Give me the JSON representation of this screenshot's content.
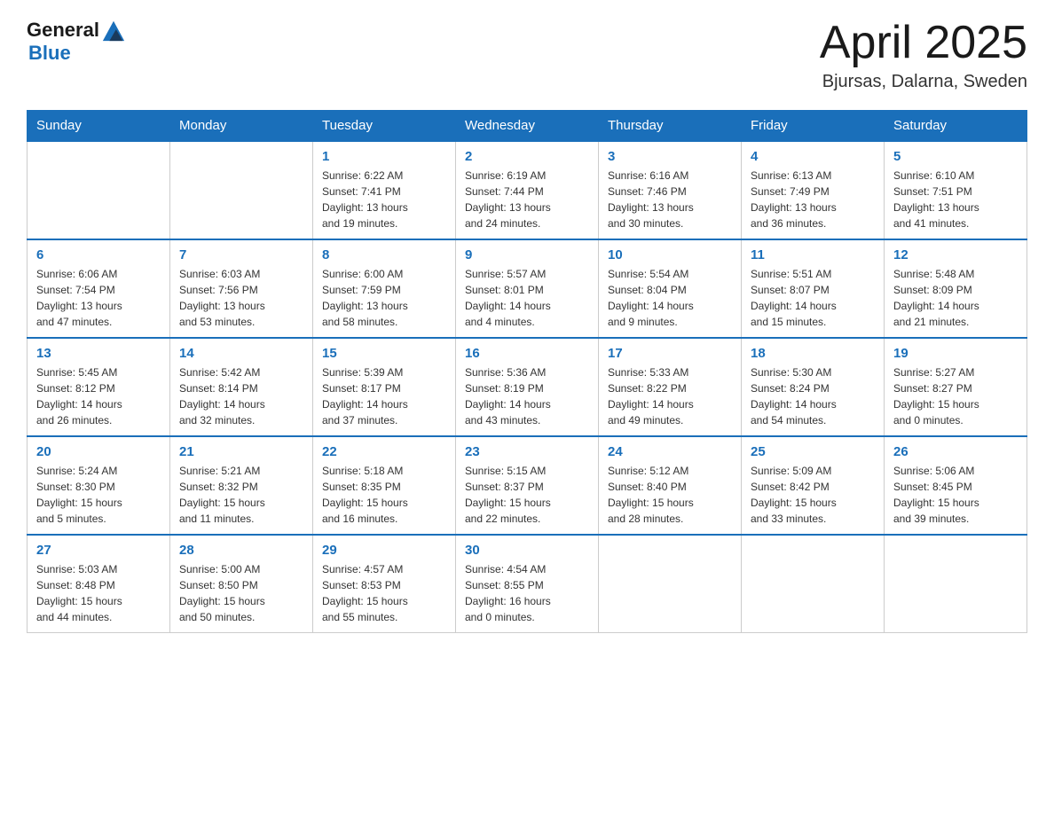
{
  "header": {
    "logo_general": "General",
    "logo_blue": "Blue",
    "month_title": "April 2025",
    "location": "Bjursas, Dalarna, Sweden"
  },
  "weekdays": [
    "Sunday",
    "Monday",
    "Tuesday",
    "Wednesday",
    "Thursday",
    "Friday",
    "Saturday"
  ],
  "weeks": [
    [
      {
        "day": "",
        "info": ""
      },
      {
        "day": "",
        "info": ""
      },
      {
        "day": "1",
        "info": "Sunrise: 6:22 AM\nSunset: 7:41 PM\nDaylight: 13 hours\nand 19 minutes."
      },
      {
        "day": "2",
        "info": "Sunrise: 6:19 AM\nSunset: 7:44 PM\nDaylight: 13 hours\nand 24 minutes."
      },
      {
        "day": "3",
        "info": "Sunrise: 6:16 AM\nSunset: 7:46 PM\nDaylight: 13 hours\nand 30 minutes."
      },
      {
        "day": "4",
        "info": "Sunrise: 6:13 AM\nSunset: 7:49 PM\nDaylight: 13 hours\nand 36 minutes."
      },
      {
        "day": "5",
        "info": "Sunrise: 6:10 AM\nSunset: 7:51 PM\nDaylight: 13 hours\nand 41 minutes."
      }
    ],
    [
      {
        "day": "6",
        "info": "Sunrise: 6:06 AM\nSunset: 7:54 PM\nDaylight: 13 hours\nand 47 minutes."
      },
      {
        "day": "7",
        "info": "Sunrise: 6:03 AM\nSunset: 7:56 PM\nDaylight: 13 hours\nand 53 minutes."
      },
      {
        "day": "8",
        "info": "Sunrise: 6:00 AM\nSunset: 7:59 PM\nDaylight: 13 hours\nand 58 minutes."
      },
      {
        "day": "9",
        "info": "Sunrise: 5:57 AM\nSunset: 8:01 PM\nDaylight: 14 hours\nand 4 minutes."
      },
      {
        "day": "10",
        "info": "Sunrise: 5:54 AM\nSunset: 8:04 PM\nDaylight: 14 hours\nand 9 minutes."
      },
      {
        "day": "11",
        "info": "Sunrise: 5:51 AM\nSunset: 8:07 PM\nDaylight: 14 hours\nand 15 minutes."
      },
      {
        "day": "12",
        "info": "Sunrise: 5:48 AM\nSunset: 8:09 PM\nDaylight: 14 hours\nand 21 minutes."
      }
    ],
    [
      {
        "day": "13",
        "info": "Sunrise: 5:45 AM\nSunset: 8:12 PM\nDaylight: 14 hours\nand 26 minutes."
      },
      {
        "day": "14",
        "info": "Sunrise: 5:42 AM\nSunset: 8:14 PM\nDaylight: 14 hours\nand 32 minutes."
      },
      {
        "day": "15",
        "info": "Sunrise: 5:39 AM\nSunset: 8:17 PM\nDaylight: 14 hours\nand 37 minutes."
      },
      {
        "day": "16",
        "info": "Sunrise: 5:36 AM\nSunset: 8:19 PM\nDaylight: 14 hours\nand 43 minutes."
      },
      {
        "day": "17",
        "info": "Sunrise: 5:33 AM\nSunset: 8:22 PM\nDaylight: 14 hours\nand 49 minutes."
      },
      {
        "day": "18",
        "info": "Sunrise: 5:30 AM\nSunset: 8:24 PM\nDaylight: 14 hours\nand 54 minutes."
      },
      {
        "day": "19",
        "info": "Sunrise: 5:27 AM\nSunset: 8:27 PM\nDaylight: 15 hours\nand 0 minutes."
      }
    ],
    [
      {
        "day": "20",
        "info": "Sunrise: 5:24 AM\nSunset: 8:30 PM\nDaylight: 15 hours\nand 5 minutes."
      },
      {
        "day": "21",
        "info": "Sunrise: 5:21 AM\nSunset: 8:32 PM\nDaylight: 15 hours\nand 11 minutes."
      },
      {
        "day": "22",
        "info": "Sunrise: 5:18 AM\nSunset: 8:35 PM\nDaylight: 15 hours\nand 16 minutes."
      },
      {
        "day": "23",
        "info": "Sunrise: 5:15 AM\nSunset: 8:37 PM\nDaylight: 15 hours\nand 22 minutes."
      },
      {
        "day": "24",
        "info": "Sunrise: 5:12 AM\nSunset: 8:40 PM\nDaylight: 15 hours\nand 28 minutes."
      },
      {
        "day": "25",
        "info": "Sunrise: 5:09 AM\nSunset: 8:42 PM\nDaylight: 15 hours\nand 33 minutes."
      },
      {
        "day": "26",
        "info": "Sunrise: 5:06 AM\nSunset: 8:45 PM\nDaylight: 15 hours\nand 39 minutes."
      }
    ],
    [
      {
        "day": "27",
        "info": "Sunrise: 5:03 AM\nSunset: 8:48 PM\nDaylight: 15 hours\nand 44 minutes."
      },
      {
        "day": "28",
        "info": "Sunrise: 5:00 AM\nSunset: 8:50 PM\nDaylight: 15 hours\nand 50 minutes."
      },
      {
        "day": "29",
        "info": "Sunrise: 4:57 AM\nSunset: 8:53 PM\nDaylight: 15 hours\nand 55 minutes."
      },
      {
        "day": "30",
        "info": "Sunrise: 4:54 AM\nSunset: 8:55 PM\nDaylight: 16 hours\nand 0 minutes."
      },
      {
        "day": "",
        "info": ""
      },
      {
        "day": "",
        "info": ""
      },
      {
        "day": "",
        "info": ""
      }
    ]
  ]
}
